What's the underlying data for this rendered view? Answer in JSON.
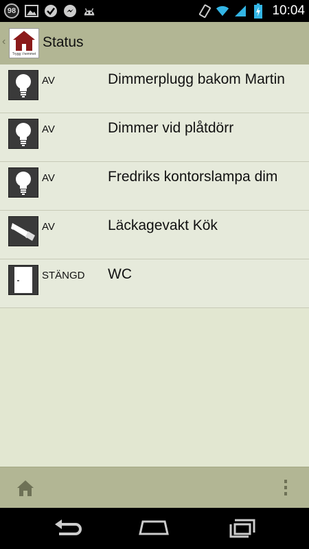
{
  "status_bar": {
    "notification_count": "98",
    "time": "10:04",
    "icons": [
      "notification-count-icon",
      "image-icon",
      "check-badge-icon",
      "messenger-icon",
      "android-icon",
      "rotation-icon",
      "wifi-icon",
      "signal-icon",
      "battery-charging-icon"
    ]
  },
  "action_bar": {
    "title": "Status",
    "logo_text": "Trygg i hemmet"
  },
  "devices": [
    {
      "state": "AV",
      "name": "Dimmerplugg bakom Martin",
      "icon": "lightbulb-icon"
    },
    {
      "state": "AV",
      "name": "Dimmer vid plåtdörr",
      "icon": "lightbulb-icon"
    },
    {
      "state": "AV",
      "name": "Fredriks kontorslampa dim",
      "icon": "lightbulb-icon"
    },
    {
      "state": "AV",
      "name": "Läckagevakt Kök",
      "icon": "leak-sensor-icon"
    },
    {
      "state": "STÄNGD",
      "name": "WC",
      "icon": "door-sensor-icon"
    }
  ],
  "bottom_bar": {
    "icons": [
      "home-icon",
      "overflow-menu-icon"
    ]
  },
  "nav_bar": {
    "icons": [
      "back-icon",
      "home-nav-icon",
      "recent-apps-icon"
    ]
  }
}
